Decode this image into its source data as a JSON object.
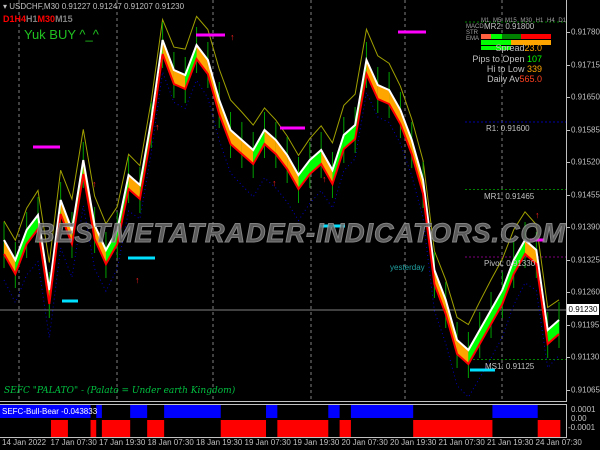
{
  "header": {
    "symbol_line": "USDCHF,M30  0.91227 0.91247 0.91207 0.91230"
  },
  "timeframes": [
    {
      "label": "D1",
      "color": "#ff0000"
    },
    {
      "label": "H4",
      "color": "#ff0000"
    },
    {
      "label": "H1",
      "color": "#808080"
    },
    {
      "label": "M30",
      "color": "#ff0000"
    },
    {
      "label": "M15",
      "color": "#808080"
    }
  ],
  "signal_text": "Yuk BUY ^_^",
  "footer_caption": "SEFC \"PALATO\" - (Palato = Under earth Kingdom)",
  "watermark": "BESTMETATRADER-INDICATORS.COM",
  "panel": {
    "tf_labels": [
      "M1",
      "M5",
      "M15",
      "M30",
      "H1",
      "H4",
      "D1"
    ],
    "row_labels": [
      "MACD",
      "STR",
      "EMA"
    ],
    "spread_label": "Spread",
    "spread_value": "23.0",
    "pips_label": "Pips to Open",
    "pips_value": "107",
    "hilo_label": "Hi to Low",
    "hilo_value": "339",
    "daily_label": "Daily Av",
    "daily_value": "565.0"
  },
  "pivots": {
    "mr2": "MR2: 0.91800",
    "r1": "R1: 0.91600",
    "mr1": "MR1: 0.91465",
    "pivot": "Pivot: 0.91330",
    "ms1": "MS1: 0.91125",
    "yesterday": "yesterday"
  },
  "price_axis": [
    "0.91780",
    "0.91715",
    "0.91650",
    "0.91585",
    "0.91520",
    "0.91455",
    "0.91390",
    "0.91325",
    "0.91260",
    "0.91195",
    "0.91130",
    "0.91065"
  ],
  "current_price": "0.91230",
  "sub_window": {
    "title": "SEFC-Bull-Bear -0.043833",
    "axis": [
      "0.0001",
      "0.00",
      "-0.0001"
    ]
  },
  "time_axis": [
    "14 Jan 2022",
    "17 Jan 07:30",
    "17 Jan 19:30",
    "18 Jan 07:30",
    "18 Jan 19:30",
    "19 Jan 07:30",
    "19 Jan 19:30",
    "20 Jan 07:30",
    "20 Jan 19:30",
    "21 Jan 07:30",
    "21 Jan 19:30",
    "24 Jan 07:30"
  ],
  "colors": {
    "bull": "#00ff00",
    "bear": "#ffa500",
    "line": "#ff0000",
    "blue_hist": "#0000ff",
    "red_hist": "#ff0000"
  },
  "chart_data": {
    "type": "line",
    "symbol": "USDCHF",
    "timeframe": "M30",
    "ylim": [
      0.91035,
      0.9183
    ],
    "close": [
      0.91364,
      0.91324,
      0.91384,
      0.91414,
      0.91264,
      0.91444,
      0.91384,
      0.91524,
      0.91394,
      0.91344,
      0.91384,
      0.91494,
      0.91474,
      0.91604,
      0.91764,
      0.91704,
      0.91694,
      0.91754,
      0.91724,
      0.91644,
      0.91584,
      0.91564,
      0.91544,
      0.91584,
      0.91564,
      0.91534,
      0.91494,
      0.91524,
      0.91544,
      0.91504,
      0.91574,
      0.91594,
      0.91724,
      0.91674,
      0.91664,
      0.91624,
      0.91564,
      0.91484,
      0.91304,
      0.91244,
      0.91164,
      0.91144,
      0.91184,
      0.91224,
      0.91264,
      0.91324,
      0.91364,
      0.91344,
      0.91184,
      0.91204
    ],
    "pivot_levels": {
      "MR2": 0.918,
      "R1": 0.916,
      "MR1": 0.91465,
      "Pivot": 0.9133,
      "MS1": 0.91125
    },
    "histogram_bars": 100,
    "bull_segments": [
      [
        0,
        16
      ],
      [
        17,
        18
      ],
      [
        23,
        26
      ],
      [
        29,
        39
      ],
      [
        47,
        49
      ],
      [
        58,
        60
      ],
      [
        62,
        73
      ],
      [
        87,
        95
      ]
    ],
    "bear_segments": [
      [
        9,
        12
      ],
      [
        16,
        17
      ],
      [
        18,
        23
      ],
      [
        26,
        29
      ],
      [
        39,
        47
      ],
      [
        49,
        58
      ],
      [
        60,
        62
      ],
      [
        73,
        87
      ],
      [
        95,
        99
      ]
    ]
  }
}
